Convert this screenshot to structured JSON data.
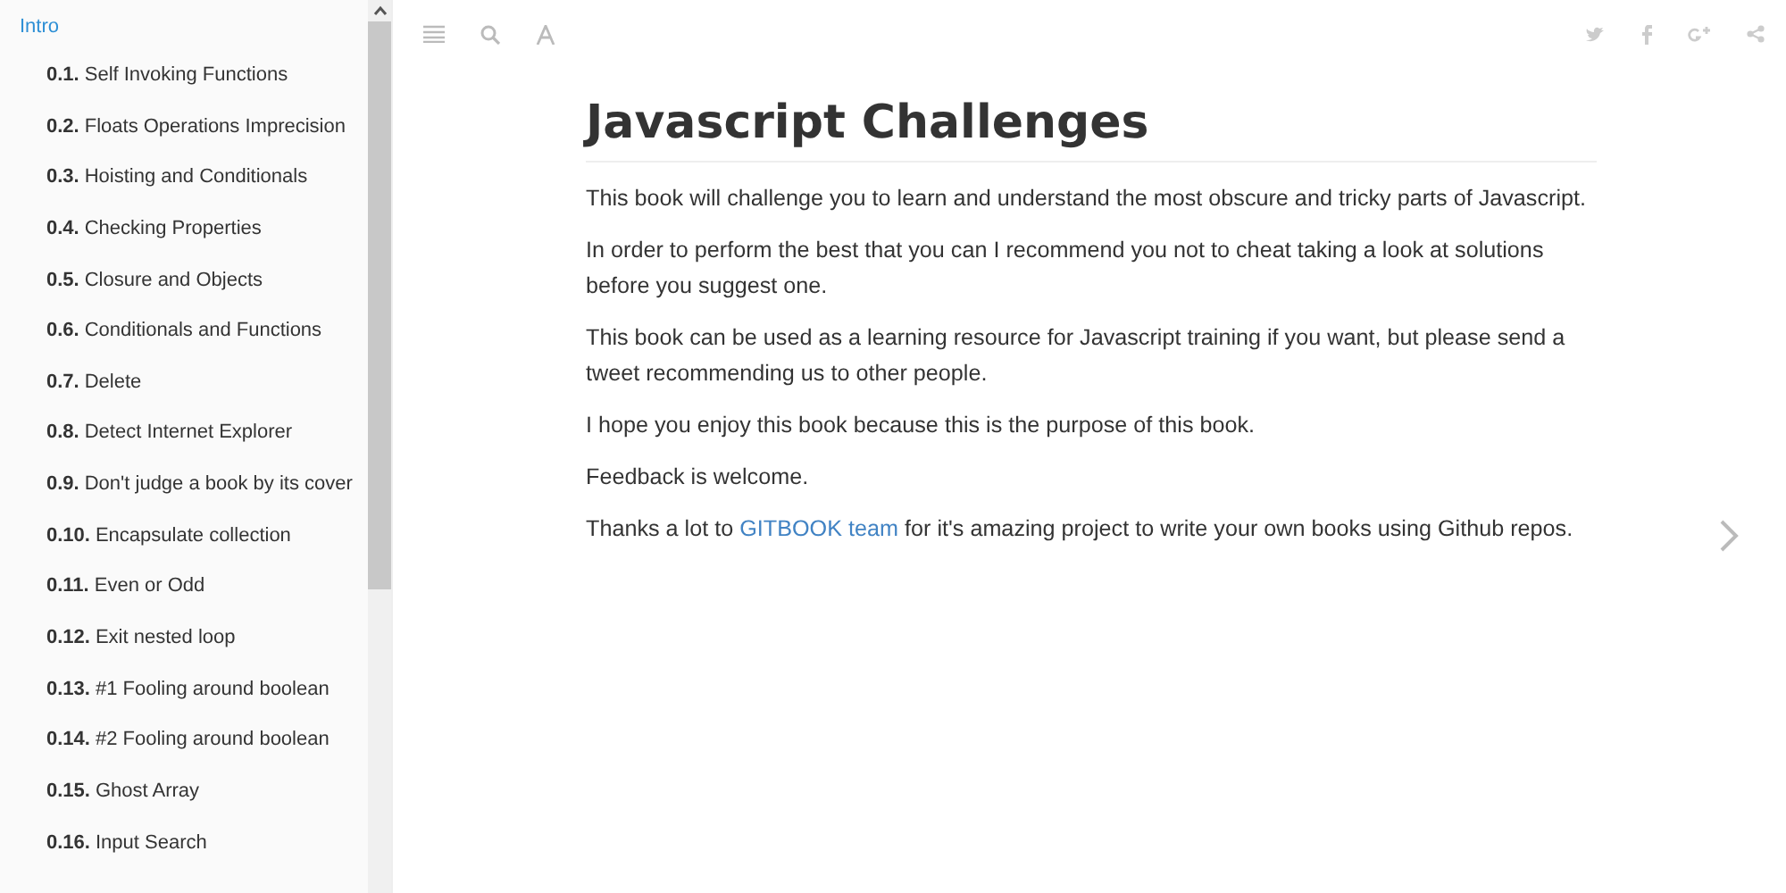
{
  "sidebar": {
    "items": [
      {
        "label": "Intro",
        "selected": true
      },
      {
        "number": "0.1.",
        "label": "Self Invoking Functions",
        "selected": false
      },
      {
        "number": "0.2.",
        "label": "Floats Operations Imprecision",
        "selected": false
      },
      {
        "number": "0.3.",
        "label": "Hoisting and Conditionals",
        "selected": false
      },
      {
        "number": "0.4.",
        "label": "Checking Properties",
        "selected": false
      },
      {
        "number": "0.5.",
        "label": "Closure and Objects",
        "selected": false
      },
      {
        "number": "0.6.",
        "label": "Conditionals and Functions",
        "selected": false
      },
      {
        "number": "0.7.",
        "label": "Delete",
        "selected": false
      },
      {
        "number": "0.8.",
        "label": "Detect Internet Explorer",
        "selected": false
      },
      {
        "number": "0.9.",
        "label": "Don't judge a book by its cover",
        "selected": false
      },
      {
        "number": "0.10.",
        "label": "Encapsulate collection",
        "selected": false
      },
      {
        "number": "0.11.",
        "label": "Even or Odd",
        "selected": false
      },
      {
        "number": "0.12.",
        "label": "Exit nested loop",
        "selected": false
      },
      {
        "number": "0.13.",
        "label": "#1 Fooling around boolean",
        "selected": false
      },
      {
        "number": "0.14.",
        "label": "#2 Fooling around boolean",
        "selected": false
      },
      {
        "number": "0.15.",
        "label": "Ghost Array",
        "selected": false
      },
      {
        "number": "0.16.",
        "label": "Input Search",
        "selected": false
      }
    ]
  },
  "page": {
    "title": "Javascript Challenges",
    "paragraphs": [
      {
        "text": "This book will challenge you to learn and understand the most obscure and tricky parts of Javascript."
      },
      {
        "text": "In order to perform the best that you can I recommend you not to cheat taking a look at solutions before you suggest one."
      },
      {
        "text": "This book can be used as a learning resource for Javascript training if you want, but please send a tweet recommending us to other people."
      },
      {
        "text": "I hope you enjoy this book because this is the purpose of this book."
      },
      {
        "text": "Feedback is welcome."
      },
      {
        "text": "Thanks a lot to ",
        "link": "GITBOOK team",
        "after": " for it's amazing project to write your own books using Github repos."
      }
    ]
  }
}
